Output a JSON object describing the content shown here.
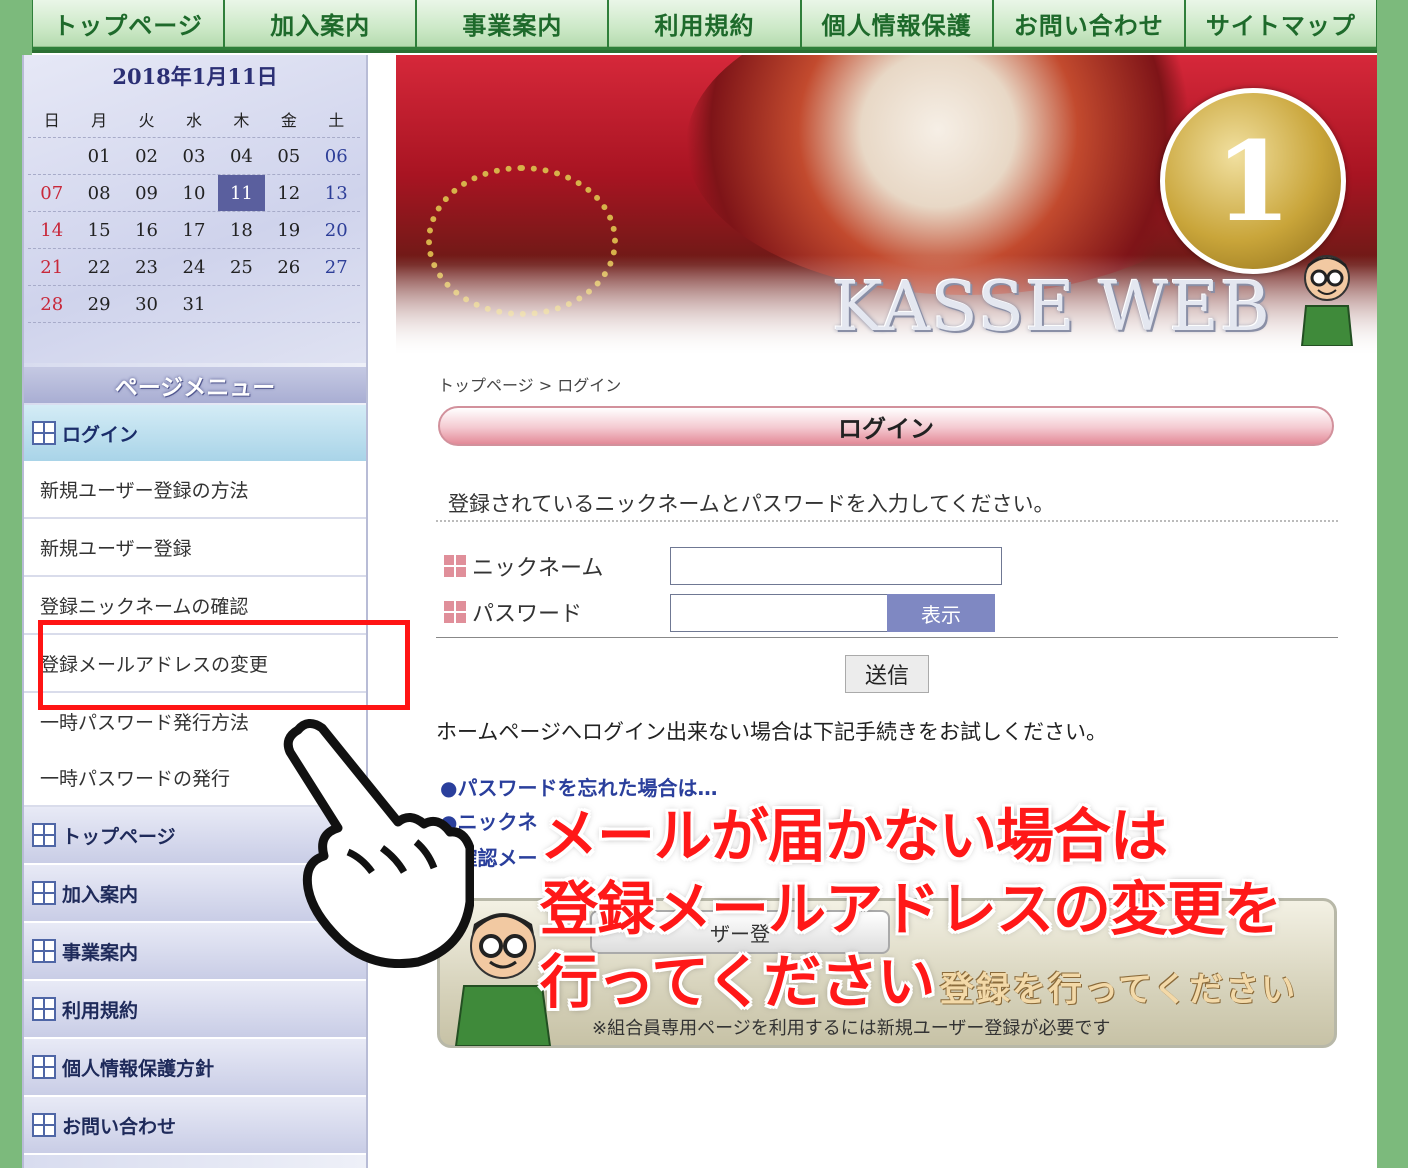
{
  "topnav": [
    "トップページ",
    "加入案内",
    "事業案内",
    "利用規約",
    "個人情報保護",
    "お問い合わせ",
    "サイトマップ"
  ],
  "calendar": {
    "title": "2018年1月11日",
    "weekdays": [
      "日",
      "月",
      "火",
      "水",
      "木",
      "金",
      "土"
    ],
    "weeks": [
      [
        "",
        "01",
        "02",
        "03",
        "04",
        "05",
        "06"
      ],
      [
        "07",
        "08",
        "09",
        "10",
        "11",
        "12",
        "13"
      ],
      [
        "14",
        "15",
        "16",
        "17",
        "18",
        "19",
        "20"
      ],
      [
        "21",
        "22",
        "23",
        "24",
        "25",
        "26",
        "27"
      ],
      [
        "28",
        "29",
        "30",
        "31",
        "",
        "",
        ""
      ]
    ],
    "today": "11"
  },
  "sidebar": {
    "menu_title": "ページメニュー",
    "active": "ログイン",
    "sub_items": [
      "新規ユーザー登録の方法",
      "新規ユーザー登録",
      "登録ニックネームの確認",
      "登録メールアドレスの変更",
      "一時パスワード発行方法",
      "一時パスワードの発行"
    ],
    "sections": [
      "トップページ",
      "加入案内",
      "事業案内",
      "利用規約",
      "個人情報保護方針",
      "お問い合わせ"
    ]
  },
  "banner": {
    "logo": "KASSE WEB",
    "medal": "1"
  },
  "main": {
    "breadcrumb": "トップページ > ログイン",
    "title": "ログイン",
    "instruction": "登録されているニックネームとパスワードを入力してください。",
    "nickname_label": "ニックネーム",
    "password_label": "パスワード",
    "show_button": "表示",
    "submit_button": "送信",
    "help_text": "ホームページへログイン出来ない場合は下記手続きをお試しください。",
    "help_links": [
      "●パスワードを忘れた場合は…",
      "●ニックネ",
      "●確認メー"
    ],
    "register_button": "ザー登",
    "register_slogan": "登録を行ってください",
    "register_note": "※組合員専用ページを利用するには新規ユーザー登録が必要です"
  },
  "annotation": {
    "lines": [
      "メールが届かない場合は",
      "登録メールアドレスの変更を",
      "行ってください"
    ]
  },
  "colors": {
    "accent_red": "#ff1818",
    "nav_green": "#1e6a2b",
    "link_blue": "#2a3f9c"
  }
}
